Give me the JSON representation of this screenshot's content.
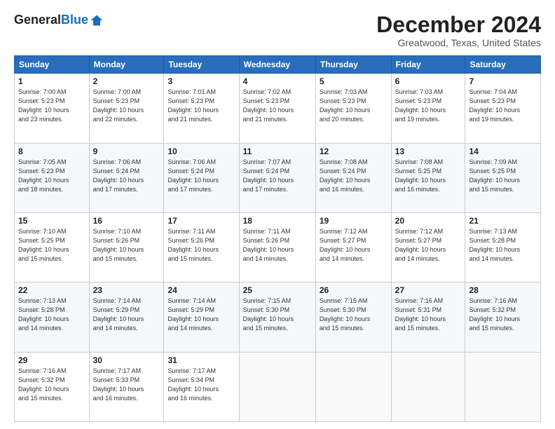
{
  "logo": {
    "general": "General",
    "blue": "Blue"
  },
  "title": "December 2024",
  "location": "Greatwood, Texas, United States",
  "days_of_week": [
    "Sunday",
    "Monday",
    "Tuesday",
    "Wednesday",
    "Thursday",
    "Friday",
    "Saturday"
  ],
  "weeks": [
    [
      {
        "day": "1",
        "info": "Sunrise: 7:00 AM\nSunset: 5:23 PM\nDaylight: 10 hours\nand 23 minutes."
      },
      {
        "day": "2",
        "info": "Sunrise: 7:00 AM\nSunset: 5:23 PM\nDaylight: 10 hours\nand 22 minutes."
      },
      {
        "day": "3",
        "info": "Sunrise: 7:01 AM\nSunset: 5:23 PM\nDaylight: 10 hours\nand 21 minutes."
      },
      {
        "day": "4",
        "info": "Sunrise: 7:02 AM\nSunset: 5:23 PM\nDaylight: 10 hours\nand 21 minutes."
      },
      {
        "day": "5",
        "info": "Sunrise: 7:03 AM\nSunset: 5:23 PM\nDaylight: 10 hours\nand 20 minutes."
      },
      {
        "day": "6",
        "info": "Sunrise: 7:03 AM\nSunset: 5:23 PM\nDaylight: 10 hours\nand 19 minutes."
      },
      {
        "day": "7",
        "info": "Sunrise: 7:04 AM\nSunset: 5:23 PM\nDaylight: 10 hours\nand 19 minutes."
      }
    ],
    [
      {
        "day": "8",
        "info": "Sunrise: 7:05 AM\nSunset: 5:23 PM\nDaylight: 10 hours\nand 18 minutes."
      },
      {
        "day": "9",
        "info": "Sunrise: 7:06 AM\nSunset: 5:24 PM\nDaylight: 10 hours\nand 17 minutes."
      },
      {
        "day": "10",
        "info": "Sunrise: 7:06 AM\nSunset: 5:24 PM\nDaylight: 10 hours\nand 17 minutes."
      },
      {
        "day": "11",
        "info": "Sunrise: 7:07 AM\nSunset: 5:24 PM\nDaylight: 10 hours\nand 17 minutes."
      },
      {
        "day": "12",
        "info": "Sunrise: 7:08 AM\nSunset: 5:24 PM\nDaylight: 10 hours\nand 16 minutes."
      },
      {
        "day": "13",
        "info": "Sunrise: 7:08 AM\nSunset: 5:25 PM\nDaylight: 10 hours\nand 16 minutes."
      },
      {
        "day": "14",
        "info": "Sunrise: 7:09 AM\nSunset: 5:25 PM\nDaylight: 10 hours\nand 15 minutes."
      }
    ],
    [
      {
        "day": "15",
        "info": "Sunrise: 7:10 AM\nSunset: 5:25 PM\nDaylight: 10 hours\nand 15 minutes."
      },
      {
        "day": "16",
        "info": "Sunrise: 7:10 AM\nSunset: 5:26 PM\nDaylight: 10 hours\nand 15 minutes."
      },
      {
        "day": "17",
        "info": "Sunrise: 7:11 AM\nSunset: 5:26 PM\nDaylight: 10 hours\nand 15 minutes."
      },
      {
        "day": "18",
        "info": "Sunrise: 7:11 AM\nSunset: 5:26 PM\nDaylight: 10 hours\nand 14 minutes."
      },
      {
        "day": "19",
        "info": "Sunrise: 7:12 AM\nSunset: 5:27 PM\nDaylight: 10 hours\nand 14 minutes."
      },
      {
        "day": "20",
        "info": "Sunrise: 7:12 AM\nSunset: 5:27 PM\nDaylight: 10 hours\nand 14 minutes."
      },
      {
        "day": "21",
        "info": "Sunrise: 7:13 AM\nSunset: 5:28 PM\nDaylight: 10 hours\nand 14 minutes."
      }
    ],
    [
      {
        "day": "22",
        "info": "Sunrise: 7:13 AM\nSunset: 5:28 PM\nDaylight: 10 hours\nand 14 minutes."
      },
      {
        "day": "23",
        "info": "Sunrise: 7:14 AM\nSunset: 5:29 PM\nDaylight: 10 hours\nand 14 minutes."
      },
      {
        "day": "24",
        "info": "Sunrise: 7:14 AM\nSunset: 5:29 PM\nDaylight: 10 hours\nand 14 minutes."
      },
      {
        "day": "25",
        "info": "Sunrise: 7:15 AM\nSunset: 5:30 PM\nDaylight: 10 hours\nand 15 minutes."
      },
      {
        "day": "26",
        "info": "Sunrise: 7:15 AM\nSunset: 5:30 PM\nDaylight: 10 hours\nand 15 minutes."
      },
      {
        "day": "27",
        "info": "Sunrise: 7:16 AM\nSunset: 5:31 PM\nDaylight: 10 hours\nand 15 minutes."
      },
      {
        "day": "28",
        "info": "Sunrise: 7:16 AM\nSunset: 5:32 PM\nDaylight: 10 hours\nand 15 minutes."
      }
    ],
    [
      {
        "day": "29",
        "info": "Sunrise: 7:16 AM\nSunset: 5:32 PM\nDaylight: 10 hours\nand 15 minutes."
      },
      {
        "day": "30",
        "info": "Sunrise: 7:17 AM\nSunset: 5:33 PM\nDaylight: 10 hours\nand 16 minutes."
      },
      {
        "day": "31",
        "info": "Sunrise: 7:17 AM\nSunset: 5:34 PM\nDaylight: 10 hours\nand 16 minutes."
      },
      {
        "day": "",
        "info": ""
      },
      {
        "day": "",
        "info": ""
      },
      {
        "day": "",
        "info": ""
      },
      {
        "day": "",
        "info": ""
      }
    ]
  ]
}
